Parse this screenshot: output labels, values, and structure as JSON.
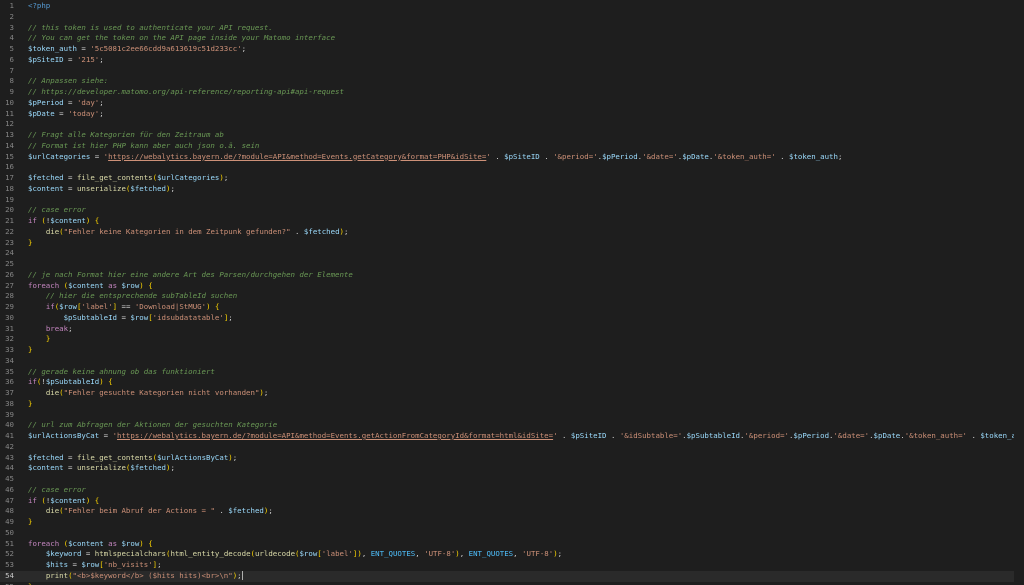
{
  "lines": [
    {
      "n": "1",
      "t": [
        [
          "tag",
          "<?php"
        ]
      ]
    },
    {
      "n": "2",
      "t": []
    },
    {
      "n": "3",
      "t": [
        [
          "c",
          "// this token is used to authenticate your API request."
        ]
      ]
    },
    {
      "n": "4",
      "t": [
        [
          "c",
          "// You can get the token on the API page inside your Matomo interface"
        ]
      ]
    },
    {
      "n": "5",
      "t": [
        [
          "v",
          "$token_auth"
        ],
        [
          "p",
          " = "
        ],
        [
          "s",
          "'5c5081c2ee66cdd9a613619c51d233cc'"
        ],
        [
          "p",
          ";"
        ]
      ]
    },
    {
      "n": "6",
      "t": [
        [
          "v",
          "$pSiteID"
        ],
        [
          "p",
          " = "
        ],
        [
          "s",
          "'215'"
        ],
        [
          "p",
          ";"
        ]
      ]
    },
    {
      "n": "7",
      "t": []
    },
    {
      "n": "8",
      "t": [
        [
          "c",
          "// Anpassen siehe:"
        ]
      ]
    },
    {
      "n": "9",
      "t": [
        [
          "c",
          "// https://developer.matomo.org/api-reference/reporting-api#api-request"
        ]
      ]
    },
    {
      "n": "10",
      "t": [
        [
          "v",
          "$pPeriod"
        ],
        [
          "p",
          " = "
        ],
        [
          "s",
          "'day'"
        ],
        [
          "p",
          ";"
        ]
      ]
    },
    {
      "n": "11",
      "t": [
        [
          "v",
          "$pDate"
        ],
        [
          "p",
          " = "
        ],
        [
          "s",
          "'today'"
        ],
        [
          "p",
          ";"
        ]
      ]
    },
    {
      "n": "12",
      "t": []
    },
    {
      "n": "13",
      "t": [
        [
          "c",
          "// Fragt alle Kategorien für den Zeitraum ab"
        ]
      ]
    },
    {
      "n": "14",
      "t": [
        [
          "c",
          "// Format ist hier PHP kann aber auch json o.ä. sein"
        ]
      ]
    },
    {
      "n": "15",
      "t": [
        [
          "v",
          "$urlCategories"
        ],
        [
          "p",
          " = "
        ],
        [
          "s",
          "'"
        ],
        [
          "u",
          "https://webalytics.bayern.de/?module=API&method=Events.getCategory&format=PHP&idSite="
        ],
        [
          "s",
          "'"
        ],
        [
          "p",
          " . "
        ],
        [
          "v",
          "$pSiteID"
        ],
        [
          "p",
          " . "
        ],
        [
          "s",
          "'&period='"
        ],
        [
          "p",
          "."
        ],
        [
          "v",
          "$pPeriod"
        ],
        [
          "p",
          "."
        ],
        [
          "s",
          "'&date='"
        ],
        [
          "p",
          "."
        ],
        [
          "v",
          "$pDate"
        ],
        [
          "p",
          "."
        ],
        [
          "s",
          "'&token_auth='"
        ],
        [
          "p",
          " . "
        ],
        [
          "v",
          "$token_auth"
        ],
        [
          "p",
          ";"
        ]
      ]
    },
    {
      "n": "16",
      "t": []
    },
    {
      "n": "17",
      "t": [
        [
          "v",
          "$fetched"
        ],
        [
          "p",
          " = "
        ],
        [
          "f",
          "file_get_contents"
        ],
        [
          "b",
          "("
        ],
        [
          "v",
          "$urlCategories"
        ],
        [
          "b",
          ")"
        ],
        [
          "p",
          ";"
        ]
      ]
    },
    {
      "n": "18",
      "t": [
        [
          "v",
          "$content"
        ],
        [
          "p",
          " = "
        ],
        [
          "f",
          "unserialize"
        ],
        [
          "b",
          "("
        ],
        [
          "v",
          "$fetched"
        ],
        [
          "b",
          ")"
        ],
        [
          "p",
          ";"
        ]
      ]
    },
    {
      "n": "19",
      "t": []
    },
    {
      "n": "20",
      "t": [
        [
          "c",
          "// case error"
        ]
      ]
    },
    {
      "n": "21",
      "t": [
        [
          "k",
          "if"
        ],
        [
          "p",
          " "
        ],
        [
          "b",
          "("
        ],
        [
          "p",
          "!"
        ],
        [
          "v",
          "$content"
        ],
        [
          "b",
          ")"
        ],
        [
          "p",
          " "
        ],
        [
          "b",
          "{"
        ]
      ]
    },
    {
      "n": "22",
      "t": [
        [
          "p",
          "    "
        ],
        [
          "f",
          "die"
        ],
        [
          "b",
          "("
        ],
        [
          "s",
          "\"Fehler keine Kategorien in dem Zeitpunk gefunden?\""
        ],
        [
          "p",
          " . "
        ],
        [
          "v",
          "$fetched"
        ],
        [
          "b",
          ")"
        ],
        [
          "p",
          ";"
        ]
      ]
    },
    {
      "n": "23",
      "t": [
        [
          "b",
          "}"
        ]
      ]
    },
    {
      "n": "24",
      "t": []
    },
    {
      "n": "25",
      "t": []
    },
    {
      "n": "26",
      "t": [
        [
          "c",
          "// je nach Format hier eine andere Art des Parsen/durchgehen der Elemente"
        ]
      ]
    },
    {
      "n": "27",
      "t": [
        [
          "k",
          "foreach"
        ],
        [
          "p",
          " "
        ],
        [
          "b",
          "("
        ],
        [
          "v",
          "$content"
        ],
        [
          "p",
          " "
        ],
        [
          "k",
          "as"
        ],
        [
          "p",
          " "
        ],
        [
          "v",
          "$row"
        ],
        [
          "b",
          ")"
        ],
        [
          "p",
          " "
        ],
        [
          "b",
          "{"
        ]
      ]
    },
    {
      "n": "28",
      "t": [
        [
          "p",
          "    "
        ],
        [
          "c",
          "// hier die entsprechende subTableId suchen"
        ]
      ]
    },
    {
      "n": "29",
      "t": [
        [
          "p",
          "    "
        ],
        [
          "k",
          "if"
        ],
        [
          "b",
          "("
        ],
        [
          "v",
          "$row"
        ],
        [
          "b",
          "["
        ],
        [
          "s",
          "'label'"
        ],
        [
          "b",
          "]"
        ],
        [
          "p",
          " == "
        ],
        [
          "s",
          "'Download|StMUG'"
        ],
        [
          "b",
          ")"
        ],
        [
          "p",
          " "
        ],
        [
          "b",
          "{"
        ]
      ]
    },
    {
      "n": "30",
      "t": [
        [
          "p",
          "        "
        ],
        [
          "v",
          "$pSubtableId"
        ],
        [
          "p",
          " = "
        ],
        [
          "v",
          "$row"
        ],
        [
          "b",
          "["
        ],
        [
          "s",
          "'idsubdatatable'"
        ],
        [
          "b",
          "]"
        ],
        [
          "p",
          ";"
        ]
      ]
    },
    {
      "n": "31",
      "t": [
        [
          "p",
          "    "
        ],
        [
          "k",
          "break"
        ],
        [
          "p",
          ";"
        ]
      ]
    },
    {
      "n": "32",
      "t": [
        [
          "p",
          "    "
        ],
        [
          "b",
          "}"
        ]
      ]
    },
    {
      "n": "33",
      "t": [
        [
          "b",
          "}"
        ]
      ]
    },
    {
      "n": "34",
      "t": []
    },
    {
      "n": "35",
      "t": [
        [
          "c",
          "// gerade keine ahnung ob das funktioniert"
        ]
      ]
    },
    {
      "n": "36",
      "t": [
        [
          "k",
          "if"
        ],
        [
          "b",
          "("
        ],
        [
          "p",
          "!"
        ],
        [
          "v",
          "$pSubtableId"
        ],
        [
          "b",
          ")"
        ],
        [
          "p",
          " "
        ],
        [
          "b",
          "{"
        ]
      ]
    },
    {
      "n": "37",
      "t": [
        [
          "p",
          "    "
        ],
        [
          "f",
          "die"
        ],
        [
          "b",
          "("
        ],
        [
          "s",
          "\"Fehler gesuchte Kategorien nicht vorhanden\""
        ],
        [
          "b",
          ")"
        ],
        [
          "p",
          ";"
        ]
      ]
    },
    {
      "n": "38",
      "t": [
        [
          "b",
          "}"
        ]
      ]
    },
    {
      "n": "39",
      "t": []
    },
    {
      "n": "40",
      "t": [
        [
          "c",
          "// url zum Abfragen der Aktionen der gesuchten Kategorie"
        ]
      ]
    },
    {
      "n": "41",
      "t": [
        [
          "v",
          "$urlActionsByCat"
        ],
        [
          "p",
          " = "
        ],
        [
          "s",
          "'"
        ],
        [
          "u",
          "https://webalytics.bayern.de/?module=API&method=Events.getActionFromCategoryId&format=html&idSite="
        ],
        [
          "s",
          "'"
        ],
        [
          "p",
          " . "
        ],
        [
          "v",
          "$pSiteID"
        ],
        [
          "p",
          " . "
        ],
        [
          "s",
          "'&idSubtable='"
        ],
        [
          "p",
          "."
        ],
        [
          "v",
          "$pSubtableId"
        ],
        [
          "p",
          "."
        ],
        [
          "s",
          "'&period='"
        ],
        [
          "p",
          "."
        ],
        [
          "v",
          "$pPeriod"
        ],
        [
          "p",
          "."
        ],
        [
          "s",
          "'&date='"
        ],
        [
          "p",
          "."
        ],
        [
          "v",
          "$pDate"
        ],
        [
          "p",
          "."
        ],
        [
          "s",
          "'&token_auth='"
        ],
        [
          "p",
          " . "
        ],
        [
          "v",
          "$token_auth"
        ],
        [
          "p",
          ";"
        ]
      ]
    },
    {
      "n": "42",
      "t": []
    },
    {
      "n": "43",
      "t": [
        [
          "v",
          "$fetched"
        ],
        [
          "p",
          " = "
        ],
        [
          "f",
          "file_get_contents"
        ],
        [
          "b",
          "("
        ],
        [
          "v",
          "$urlActionsByCat"
        ],
        [
          "b",
          ")"
        ],
        [
          "p",
          ";"
        ]
      ]
    },
    {
      "n": "44",
      "t": [
        [
          "v",
          "$content"
        ],
        [
          "p",
          " = "
        ],
        [
          "f",
          "unserialize"
        ],
        [
          "b",
          "("
        ],
        [
          "v",
          "$fetched"
        ],
        [
          "b",
          ")"
        ],
        [
          "p",
          ";"
        ]
      ]
    },
    {
      "n": "45",
      "t": []
    },
    {
      "n": "46",
      "t": [
        [
          "c",
          "// case error"
        ]
      ]
    },
    {
      "n": "47",
      "t": [
        [
          "k",
          "if"
        ],
        [
          "p",
          " "
        ],
        [
          "b",
          "("
        ],
        [
          "p",
          "!"
        ],
        [
          "v",
          "$content"
        ],
        [
          "b",
          ")"
        ],
        [
          "p",
          " "
        ],
        [
          "b",
          "{"
        ]
      ]
    },
    {
      "n": "48",
      "t": [
        [
          "p",
          "    "
        ],
        [
          "f",
          "die"
        ],
        [
          "b",
          "("
        ],
        [
          "s",
          "\"Fehler beim Abruf der Actions = \""
        ],
        [
          "p",
          " . "
        ],
        [
          "v",
          "$fetched"
        ],
        [
          "b",
          ")"
        ],
        [
          "p",
          ";"
        ]
      ]
    },
    {
      "n": "49",
      "t": [
        [
          "b",
          "}"
        ]
      ]
    },
    {
      "n": "50",
      "t": []
    },
    {
      "n": "51",
      "t": [
        [
          "k",
          "foreach"
        ],
        [
          "p",
          " "
        ],
        [
          "b",
          "("
        ],
        [
          "v",
          "$content"
        ],
        [
          "p",
          " "
        ],
        [
          "k",
          "as"
        ],
        [
          "p",
          " "
        ],
        [
          "v",
          "$row"
        ],
        [
          "b",
          ")"
        ],
        [
          "p",
          " "
        ],
        [
          "b",
          "{"
        ]
      ]
    },
    {
      "n": "52",
      "t": [
        [
          "p",
          "    "
        ],
        [
          "v",
          "$keyword"
        ],
        [
          "p",
          " = "
        ],
        [
          "f",
          "htmlspecialchars"
        ],
        [
          "b",
          "("
        ],
        [
          "f",
          "html_entity_decode"
        ],
        [
          "b",
          "("
        ],
        [
          "f",
          "urldecode"
        ],
        [
          "b",
          "("
        ],
        [
          "v",
          "$row"
        ],
        [
          "b",
          "["
        ],
        [
          "s",
          "'label'"
        ],
        [
          "b",
          "]"
        ],
        [
          "b",
          ")"
        ],
        [
          "p",
          ", "
        ],
        [
          "cn",
          "ENT_QUOTES"
        ],
        [
          "p",
          ", "
        ],
        [
          "s",
          "'UTF-8'"
        ],
        [
          "b",
          ")"
        ],
        [
          "p",
          ", "
        ],
        [
          "cn",
          "ENT_QUOTES"
        ],
        [
          "p",
          ", "
        ],
        [
          "s",
          "'UTF-8'"
        ],
        [
          "b",
          ")"
        ],
        [
          "p",
          ";"
        ]
      ]
    },
    {
      "n": "53",
      "t": [
        [
          "p",
          "    "
        ],
        [
          "v",
          "$hits"
        ],
        [
          "p",
          " = "
        ],
        [
          "v",
          "$row"
        ],
        [
          "b",
          "["
        ],
        [
          "s",
          "'nb_visits'"
        ],
        [
          "b",
          "]"
        ],
        [
          "p",
          ";"
        ]
      ]
    },
    {
      "n": "54",
      "t": [
        [
          "p",
          "    "
        ],
        [
          "f",
          "print"
        ],
        [
          "b",
          "("
        ],
        [
          "s",
          "\"<b>$keyword</b> ($hits hits)<br>\\n\""
        ],
        [
          "b",
          ")"
        ],
        [
          "p",
          ";"
        ]
      ],
      "current": true
    },
    {
      "n": "55",
      "t": [
        [
          "b",
          "}"
        ]
      ]
    }
  ]
}
